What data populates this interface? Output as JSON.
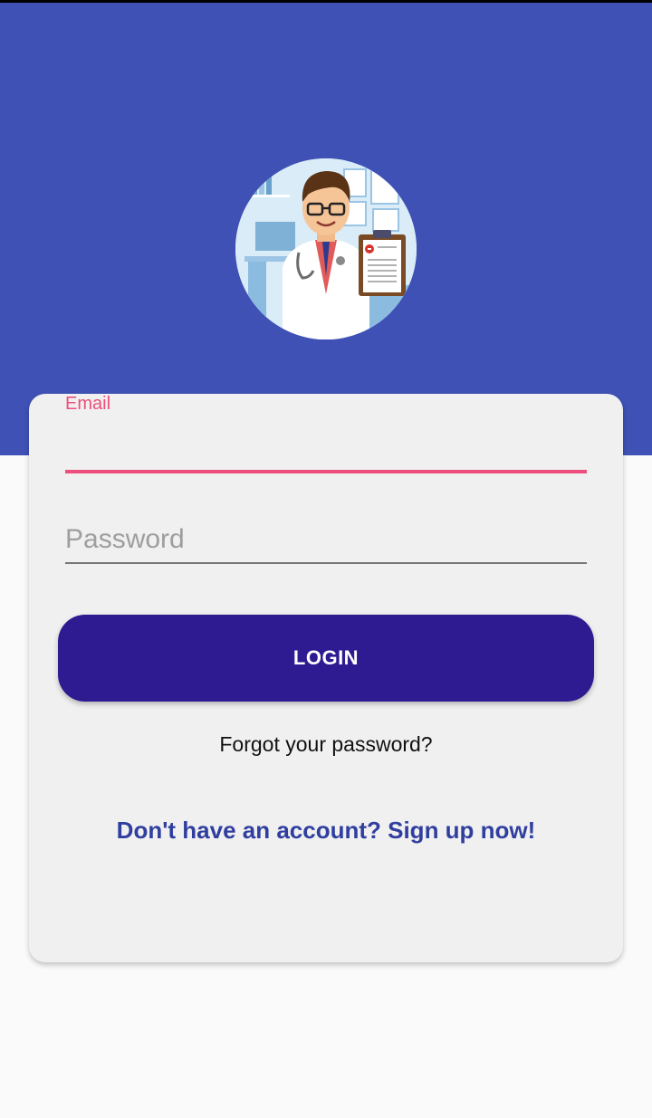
{
  "header": {
    "band_color": "#3f51b5",
    "avatar_icon": "doctor-illustration"
  },
  "login_form": {
    "email": {
      "label": "Email",
      "value": "",
      "accent_color": "#ec4f7d"
    },
    "password": {
      "placeholder": "Password",
      "value": ""
    },
    "login_button_label": "LOGIN",
    "login_button_color": "#2e1a91",
    "forgot_password_text": "Forgot your password?",
    "signup_text": "Don't have an account? Sign up now!",
    "signup_color": "#303f9f"
  }
}
